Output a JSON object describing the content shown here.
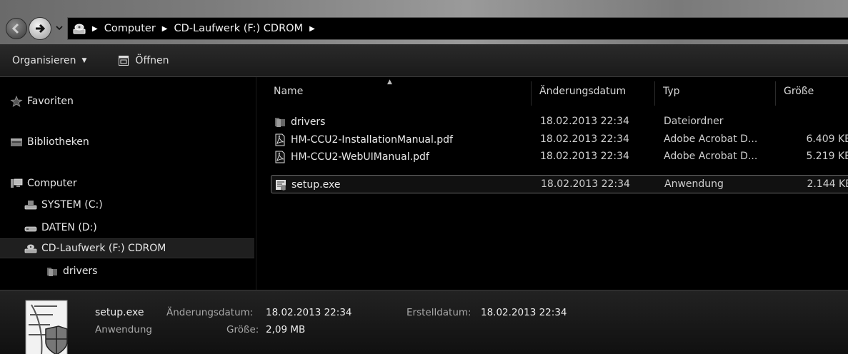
{
  "address_bar": {
    "breadcrumbs": [
      "Computer",
      "CD-Laufwerk (F:) CDROM"
    ]
  },
  "toolbar": {
    "organize_label": "Organisieren",
    "open_label": "Öffnen"
  },
  "nav": {
    "favorites": "Favoriten",
    "libraries": "Bibliotheken",
    "computer": "Computer",
    "drives": [
      "SYSTEM (C:)",
      "DATEN (D:)",
      "CD-Laufwerk (F:) CDROM"
    ],
    "subfolder": "drivers"
  },
  "columns": {
    "name": "Name",
    "date": "Änderungsdatum",
    "type": "Typ",
    "size": "Größe"
  },
  "files": [
    {
      "name": "drivers",
      "date": "18.02.2013 22:34",
      "type": "Dateiordner",
      "size": "",
      "icon": "folder-icon"
    },
    {
      "name": "HM-CCU2-InstallationManual.pdf",
      "date": "18.02.2013 22:34",
      "type": "Adobe Acrobat D...",
      "size": "6.409 KE",
      "icon": "pdf-file-icon"
    },
    {
      "name": "HM-CCU2-WebUIManual.pdf",
      "date": "18.02.2013 22:34",
      "type": "Adobe Acrobat D...",
      "size": "5.219 KE",
      "icon": "pdf-file-icon"
    },
    {
      "name": "setup.exe",
      "date": "18.02.2013 22:34",
      "type": "Anwendung",
      "size": "2.144 KE",
      "icon": "application-file-icon",
      "selected": true
    }
  ],
  "details": {
    "filename": "setup.exe",
    "filetype": "Anwendung",
    "modified_label": "Änderungsdatum:",
    "modified_value": "18.02.2013 22:34",
    "created_label": "Erstelldatum:",
    "created_value": "18.02.2013 22:34",
    "size_label": "Größe:",
    "size_value": "2,09 MB"
  }
}
